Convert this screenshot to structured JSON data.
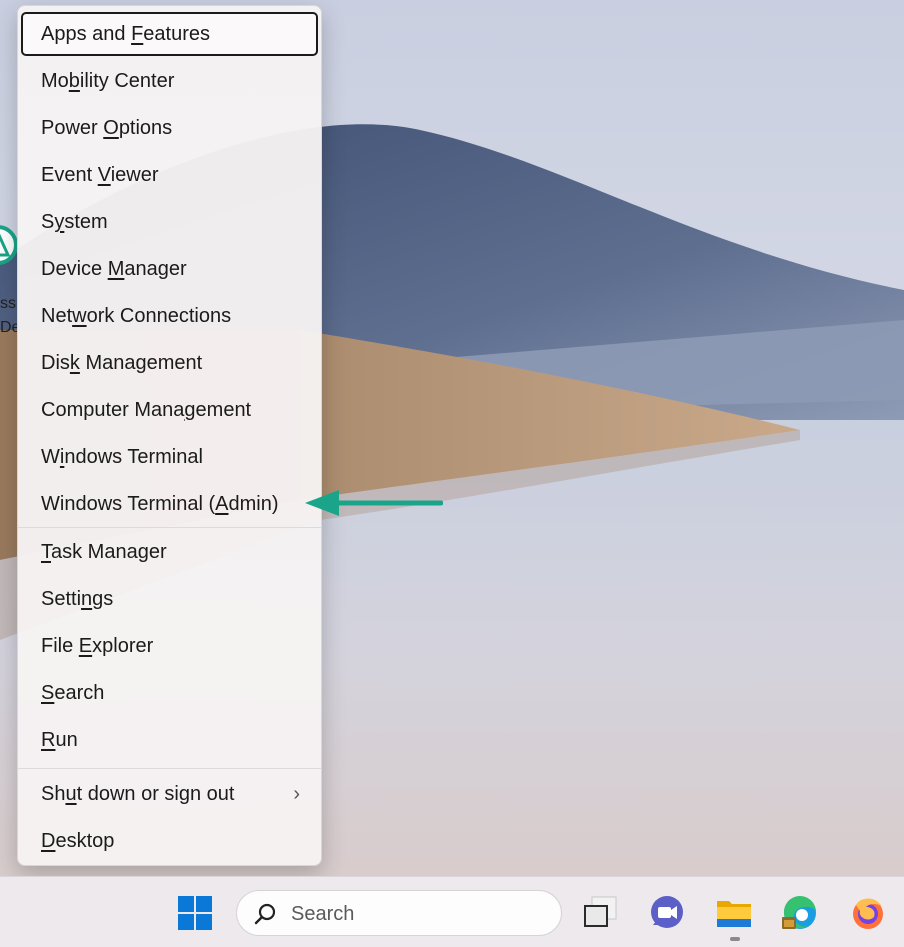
{
  "menu": {
    "groups": [
      [
        {
          "before": "Apps and ",
          "key": "F",
          "after": "eatures",
          "focused": true
        },
        {
          "before": "Mo",
          "key": "b",
          "after": "ility Center"
        },
        {
          "before": "Power ",
          "key": "O",
          "after": "ptions"
        },
        {
          "before": "Event ",
          "key": "V",
          "after": "iewer"
        },
        {
          "before": "S",
          "key": "y",
          "after": "stem"
        },
        {
          "before": "Device ",
          "key": "M",
          "after": "anager"
        },
        {
          "before": "Net",
          "key": "w",
          "after": "ork Connections"
        },
        {
          "before": "Dis",
          "key": "k",
          "after": " Management"
        },
        {
          "before": "Computer Mana",
          "key": "g",
          "after": "ement"
        },
        {
          "before": "W",
          "key": "i",
          "after": "ndows Terminal"
        },
        {
          "before": "Windows Terminal (",
          "key": "A",
          "after": "dmin)"
        }
      ],
      [
        {
          "before": "",
          "key": "T",
          "after": "ask Manager"
        },
        {
          "before": "Setti",
          "key": "n",
          "after": "gs"
        },
        {
          "before": "File ",
          "key": "E",
          "after": "xplorer"
        },
        {
          "before": "",
          "key": "S",
          "after": "earch"
        },
        {
          "before": "",
          "key": "R",
          "after": "un"
        }
      ],
      [
        {
          "before": "Sh",
          "key": "u",
          "after": "t down or sign out",
          "submenu": true
        },
        {
          "before": "",
          "key": "D",
          "after": "esktop"
        }
      ]
    ]
  },
  "desktop": {
    "icon_label_fragment": "ssi\nDe"
  },
  "taskbar": {
    "search_placeholder": "Search",
    "icons": [
      "windows-start-icon",
      "search-icon",
      "task-view-icon",
      "teams-chat-icon",
      "file-explorer-icon",
      "edge-icon",
      "firefox-icon"
    ]
  },
  "colors": {
    "annotation_arrow": "#1aa58a",
    "windows_blue": "#0a78d7"
  }
}
